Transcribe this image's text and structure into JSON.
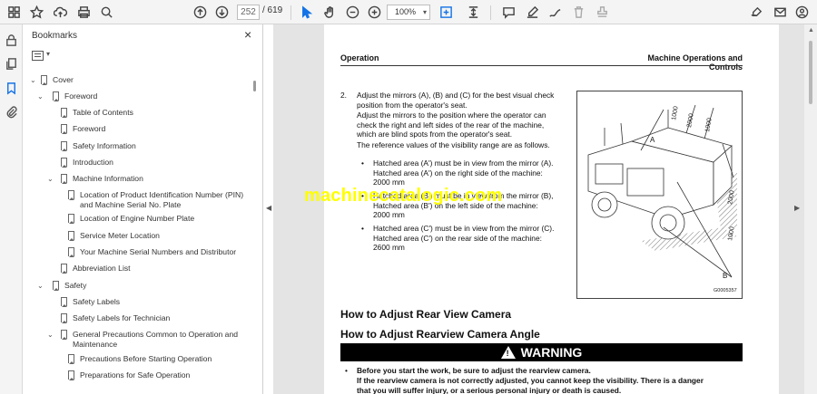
{
  "toolbar": {
    "page_current": "252",
    "page_total": "/ 619",
    "zoom": "100%",
    "zoom_caret": "▾"
  },
  "bookmarks_panel": {
    "title": "Bookmarks",
    "close_glyph": "×",
    "options_caret": "▾",
    "items": [
      {
        "label": "Cover",
        "chevron": "⌄"
      },
      {
        "label": "Foreword",
        "chevron": "⌄"
      },
      {
        "label": "Table of Contents"
      },
      {
        "label": "Foreword"
      },
      {
        "label": "Safety Information"
      },
      {
        "label": "Introduction"
      },
      {
        "label": "Machine Information",
        "chevron": "⌄"
      },
      {
        "label": "Location of Product Identification Number (PIN)",
        "label2": "and Machine Serial No. Plate"
      },
      {
        "label": "Location of Engine Number Plate"
      },
      {
        "label": "Service Meter Location"
      },
      {
        "label": "Your Machine Serial Numbers and Distributor"
      },
      {
        "label": "Abbreviation List"
      },
      {
        "label": "Safety",
        "chevron": "⌄"
      },
      {
        "label": "Safety Labels"
      },
      {
        "label": "Safety Labels for Technician"
      },
      {
        "label": "General Precautions Common to Operation and",
        "label2": "Maintenance",
        "chevron": "⌄"
      },
      {
        "label": "Precautions Before Starting Operation"
      },
      {
        "label": "Preparations for Safe Operation"
      }
    ]
  },
  "document": {
    "header_left": "Operation",
    "header_right": "Machine Operations and Controls",
    "step_number": "2.",
    "step_lines": [
      "Adjust the mirrors (A), (B) and (C) for the best visual check",
      "position from the operator's seat.",
      "Adjust the mirrors to the position where the operator can",
      "check the right and left sides of the rear of the machine,",
      "which are blind spots from the operator's seat.",
      "The reference values of the visibility range are as follows."
    ],
    "bullet_glyph": "•",
    "bullets": [
      {
        "lines": [
          "Hatched area (A') must be in view from the mirror (A).",
          "Hatched area (A') on the right side of the machine:",
          "2000 mm"
        ]
      },
      {
        "lines": [
          "Hatched area (B') must be in view from the mirror (B),",
          "Hatched area (B') on the left side of the machine:",
          "2000 mm"
        ]
      },
      {
        "lines": [
          "Hatched area (C') must be in view from the mirror (C).",
          "Hatched area (C') on the rear side of the machine:",
          "2600 mm"
        ]
      }
    ],
    "figure": {
      "code": "G0005357",
      "label_a": "A",
      "label_b": "B",
      "dims": [
        "1000",
        "2000",
        "1000",
        "2000",
        "1000"
      ]
    },
    "heading_1": "How to Adjust Rear View Camera",
    "heading_2": "How to Adjust Rearview Camera Angle",
    "warning_label": "WARNING",
    "warning_symbol": "!",
    "warning_lines": [
      "Before you start the work, be sure to adjust the rearview camera.",
      "If the rearview camera is not correctly adjusted, you cannot keep the visibility. There is a danger",
      "that you will suffer injury, or a serious personal injury or death is caused."
    ]
  },
  "watermark": "machinecatalogic.com",
  "colors": {
    "accent": "#1473e6",
    "watermark": "#ffff00",
    "warning_bg": "#000000"
  }
}
